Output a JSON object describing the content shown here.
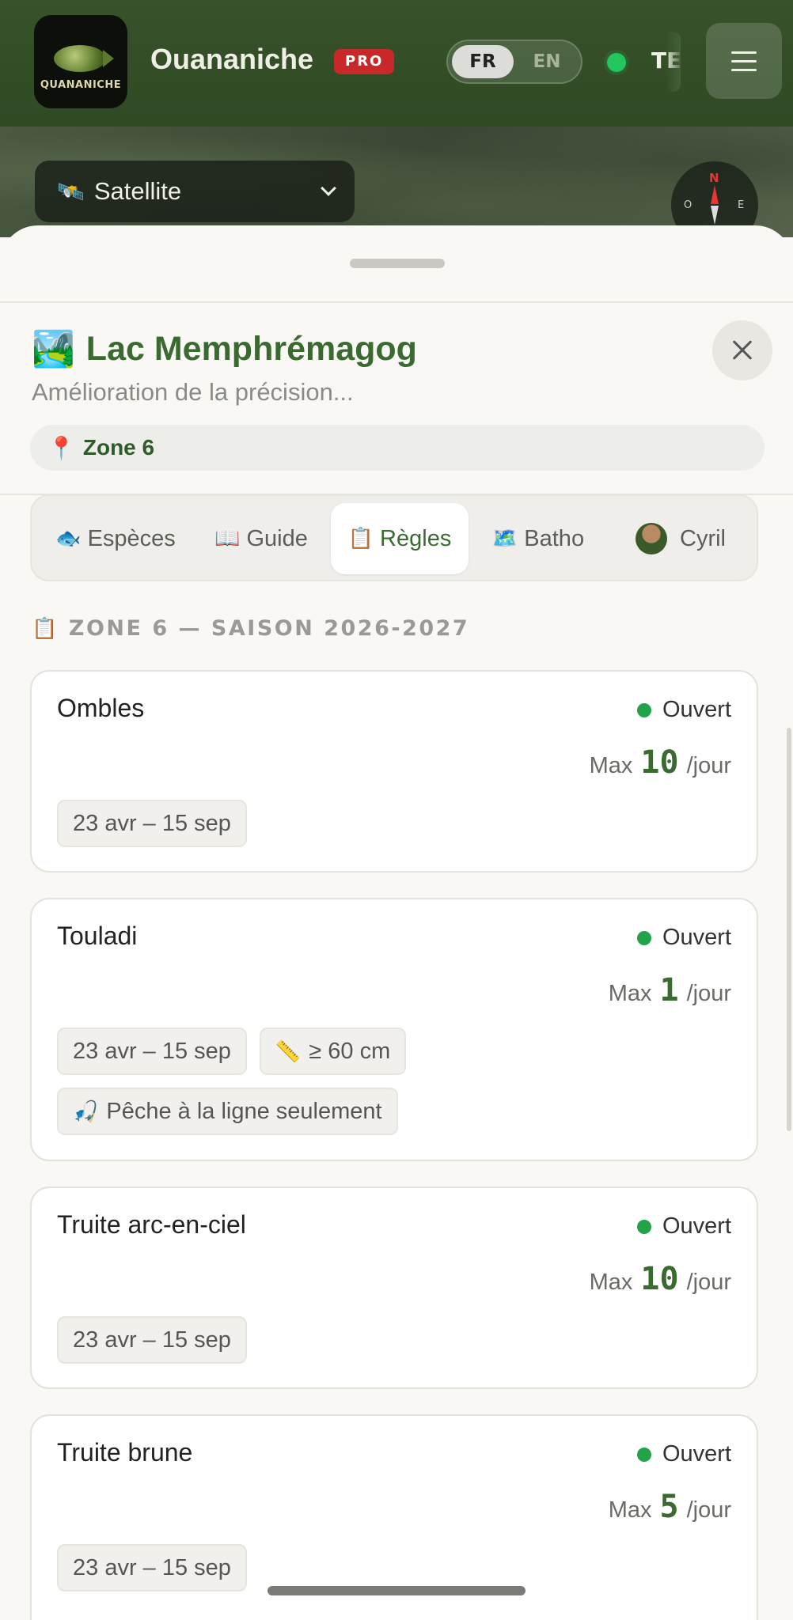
{
  "header": {
    "logo_text": "QUANANICHE",
    "app_title": "Ouananiche",
    "pro_badge": "PRO",
    "lang_fr": "FR",
    "lang_en": "EN",
    "truncated_label": "TE",
    "status_color": "#22c55e"
  },
  "map": {
    "layer_label": "Satellite",
    "compass": {
      "n": "N",
      "o": "O",
      "e": "E"
    }
  },
  "sheet": {
    "title_emoji": "🏞️",
    "title": "Lac Memphrémagog",
    "subtitle": "Amélioration de la précision...",
    "zone_pill": "Zone 6",
    "tabs": [
      {
        "icon": "🐟",
        "label": "Espèces"
      },
      {
        "icon": "📖",
        "label": "Guide"
      },
      {
        "icon": "📋",
        "label": "Règles",
        "active": true
      },
      {
        "icon": "🗺️",
        "label": "Batho"
      },
      {
        "icon": "avatar",
        "label": "Cyril"
      }
    ],
    "section_heading": "ZONE 6 — SAISON 2026-2027",
    "regulations": [
      {
        "species": "Ombles",
        "status": "Ouvert",
        "limit_prefix": "Max",
        "limit": "10",
        "limit_suffix": "/jour",
        "tags": [
          "23 avr – 15 sep"
        ]
      },
      {
        "species": "Touladi",
        "status": "Ouvert",
        "limit_prefix": "Max",
        "limit": "1",
        "limit_suffix": "/jour",
        "tags": [
          "23 avr – 15 sep",
          "≥ 60 cm",
          "Pêche à la ligne seulement"
        ]
      },
      {
        "species": "Truite arc-en-ciel",
        "status": "Ouvert",
        "limit_prefix": "Max",
        "limit": "10",
        "limit_suffix": "/jour",
        "tags": [
          "23 avr – 15 sep"
        ]
      },
      {
        "species": "Truite brune",
        "status": "Ouvert",
        "limit_prefix": "Max",
        "limit": "5",
        "limit_suffix": "/jour",
        "tags": [
          "23 avr – 15 sep"
        ]
      }
    ]
  },
  "colors": {
    "accent_green": "#3b6a31",
    "open_dot": "#22a34a",
    "pro_red": "#c82828"
  }
}
